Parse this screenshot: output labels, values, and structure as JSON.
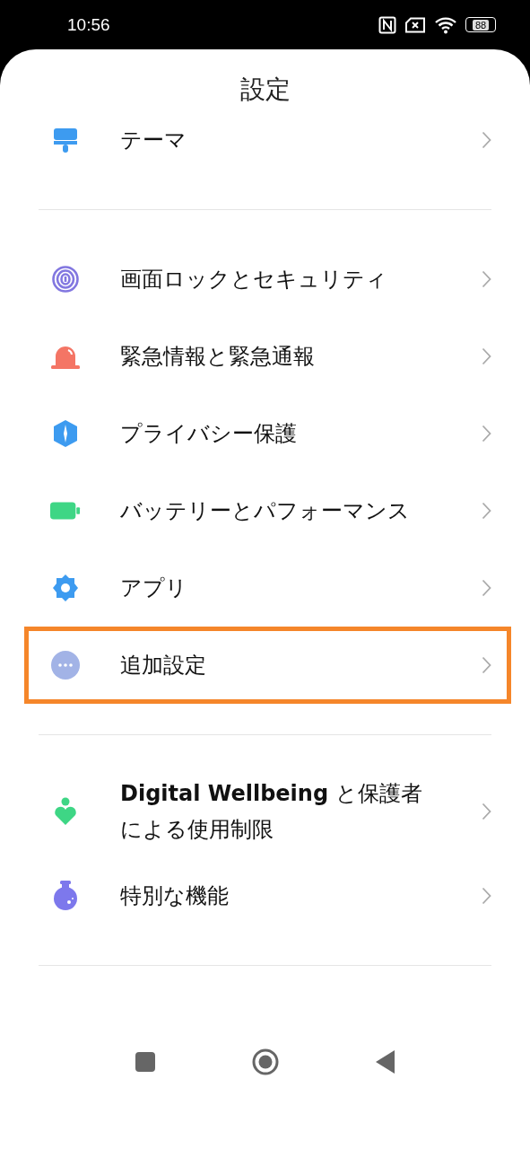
{
  "status_bar": {
    "time": "10:56",
    "battery": "88"
  },
  "title": "設定",
  "sections": [
    {
      "items": [
        {
          "label": "テーマ",
          "highlighted": false
        }
      ]
    },
    {
      "items": [
        {
          "label": "画面ロックとセキュリティ",
          "highlighted": false
        },
        {
          "label": "緊急情報と緊急通報",
          "highlighted": false
        },
        {
          "label": "プライバシー保護",
          "highlighted": false
        },
        {
          "label": "バッテリーとパフォーマンス",
          "highlighted": false
        },
        {
          "label": "アプリ",
          "highlighted": false
        },
        {
          "label": "追加設定",
          "highlighted": true
        }
      ]
    },
    {
      "items": [
        {
          "label": "**Digital Wellbeing** と保護者による使用制限",
          "highlighted": false
        },
        {
          "label": "特別な機能",
          "highlighted": false
        }
      ]
    }
  ]
}
